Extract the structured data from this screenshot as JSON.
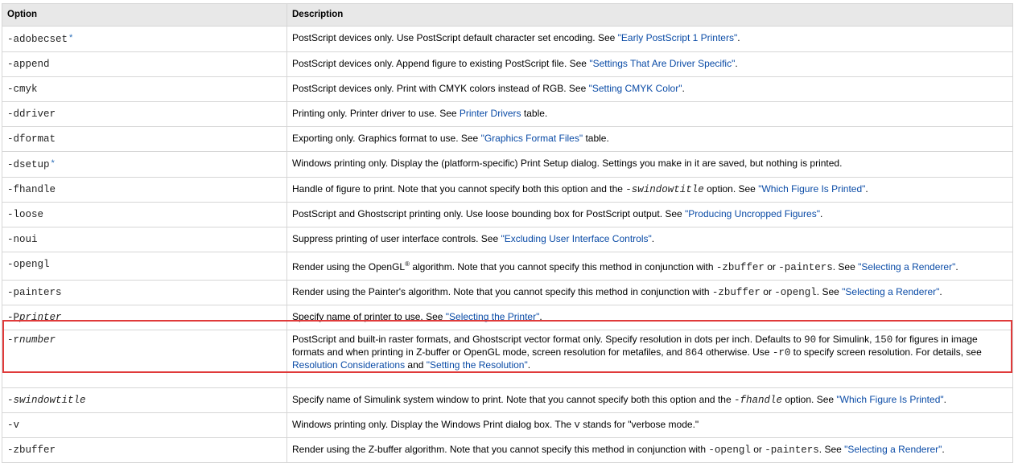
{
  "table": {
    "headers": {
      "option": "Option",
      "description": "Description"
    },
    "rows": [
      {
        "option": "-adobecset",
        "star": "*",
        "desc": [
          "PostScript devices only. Use PostScript default character set encoding. See "
        ],
        "link1": "\"Early PostScript 1 Printers\"",
        "tail": "."
      },
      {
        "option": "-append",
        "desc": [
          "PostScript devices only. Append figure to existing PostScript file. See "
        ],
        "link1": "\"Settings That Are Driver Specific\"",
        "tail": "."
      },
      {
        "option": "-cmyk",
        "desc": [
          "PostScript devices only. Print with CMYK colors instead of RGB. See "
        ],
        "link1": "\"Setting CMYK Color\"",
        "tail": "."
      },
      {
        "option": "-ddriver",
        "desc": [
          "Printing only. Printer driver to use. See "
        ],
        "link1": "Printer Drivers",
        "tail": " table."
      },
      {
        "option": "-dformat",
        "desc": [
          "Exporting only. Graphics format to use. See "
        ],
        "link1": "\"Graphics Format Files\"",
        "tail": " table."
      },
      {
        "option": "-dsetup",
        "star": "*",
        "desc": [
          "Windows printing only. Display the (platform-specific) Print Setup dialog. Settings you make in it are saved, but nothing is printed."
        ]
      },
      {
        "option": "-fhandle",
        "desc": [
          "Handle of figure to print. Note that you cannot specify both this option and the ",
          " option. See "
        ],
        "code": "-swindowtitle",
        "link1": "\"Which Figure Is Printed\"",
        "tail": "."
      },
      {
        "option": "-loose",
        "desc": [
          "PostScript and Ghostscript printing only. Use loose bounding box for PostScript output. See "
        ],
        "link1": "\"Producing Uncropped Figures\"",
        "tail": "."
      },
      {
        "option": "-noui",
        "desc": [
          "Suppress printing of user interface controls. See "
        ],
        "link1": "\"Excluding User Interface Controls\"",
        "tail": "."
      },
      {
        "option": "-opengl",
        "desc": [
          "Render using the OpenGL",
          " algorithm. Note that you cannot specify this method in conjunction with ",
          " or ",
          ". See "
        ],
        "reg": "®",
        "code1": "-zbuffer",
        "code2": "-painters",
        "link1": "\"Selecting a Renderer\"",
        "tail": "."
      },
      {
        "option": "-painters",
        "desc": [
          "Render using the Painter's algorithm. Note that you cannot specify this method in conjunction with ",
          " or ",
          ". See "
        ],
        "code1": "-zbuffer",
        "code2": "-opengl",
        "link1": "\"Selecting a Renderer\"",
        "tail": "."
      },
      {
        "option_prefix": "-P",
        "option_italic": "printer",
        "desc": [
          "Specify name of printer to use. See "
        ],
        "link1": "\"Selecting the Printer\"",
        "tail": "."
      },
      {
        "option_prefix": "-r",
        "option_italic": "number",
        "desc": [
          "PostScript and built-in raster formats, and Ghostscript vector format only. Specify resolution in dots per inch. Defaults to ",
          " for Simulink, ",
          " for figures in image formats and when printing in Z-buffer or OpenGL mode, screen resolution for metafiles, and ",
          " otherwise. Use ",
          " to specify screen resolution. For details, see ",
          " and "
        ],
        "code1": "90",
        "code2": "150",
        "code3": "864",
        "code4": "-r0",
        "link1": "Resolution Considerations",
        "link2": "\"Setting the Resolution\"",
        "tail": "."
      },
      {
        "option_prefix": "-",
        "option_italic": "swindowtitle",
        "desc": [
          "Specify name of Simulink system window to print. Note that you cannot specify both this option and the ",
          " option. See "
        ],
        "code_prefix": "-",
        "code_italic": "fhandle",
        "link1": "\"Which Figure Is Printed\"",
        "tail": "."
      },
      {
        "option": "-v",
        "desc": [
          "Windows printing only. Display the Windows Print dialog box. The ",
          " stands for \"verbose mode.\""
        ],
        "code1": "v"
      },
      {
        "option": "-zbuffer",
        "desc": [
          "Render using the Z-buffer algorithm. Note that you cannot specify this method in conjunction with ",
          " or ",
          ". See "
        ],
        "code1": "-opengl",
        "code2": "-painters",
        "link1": "\"Selecting a Renderer\"",
        "tail": "."
      }
    ]
  },
  "colors": {
    "link": "#0a4ba6",
    "header_bg": "#e8e8e8",
    "border": "#d6d6d6",
    "highlight": "#e03a3a"
  }
}
